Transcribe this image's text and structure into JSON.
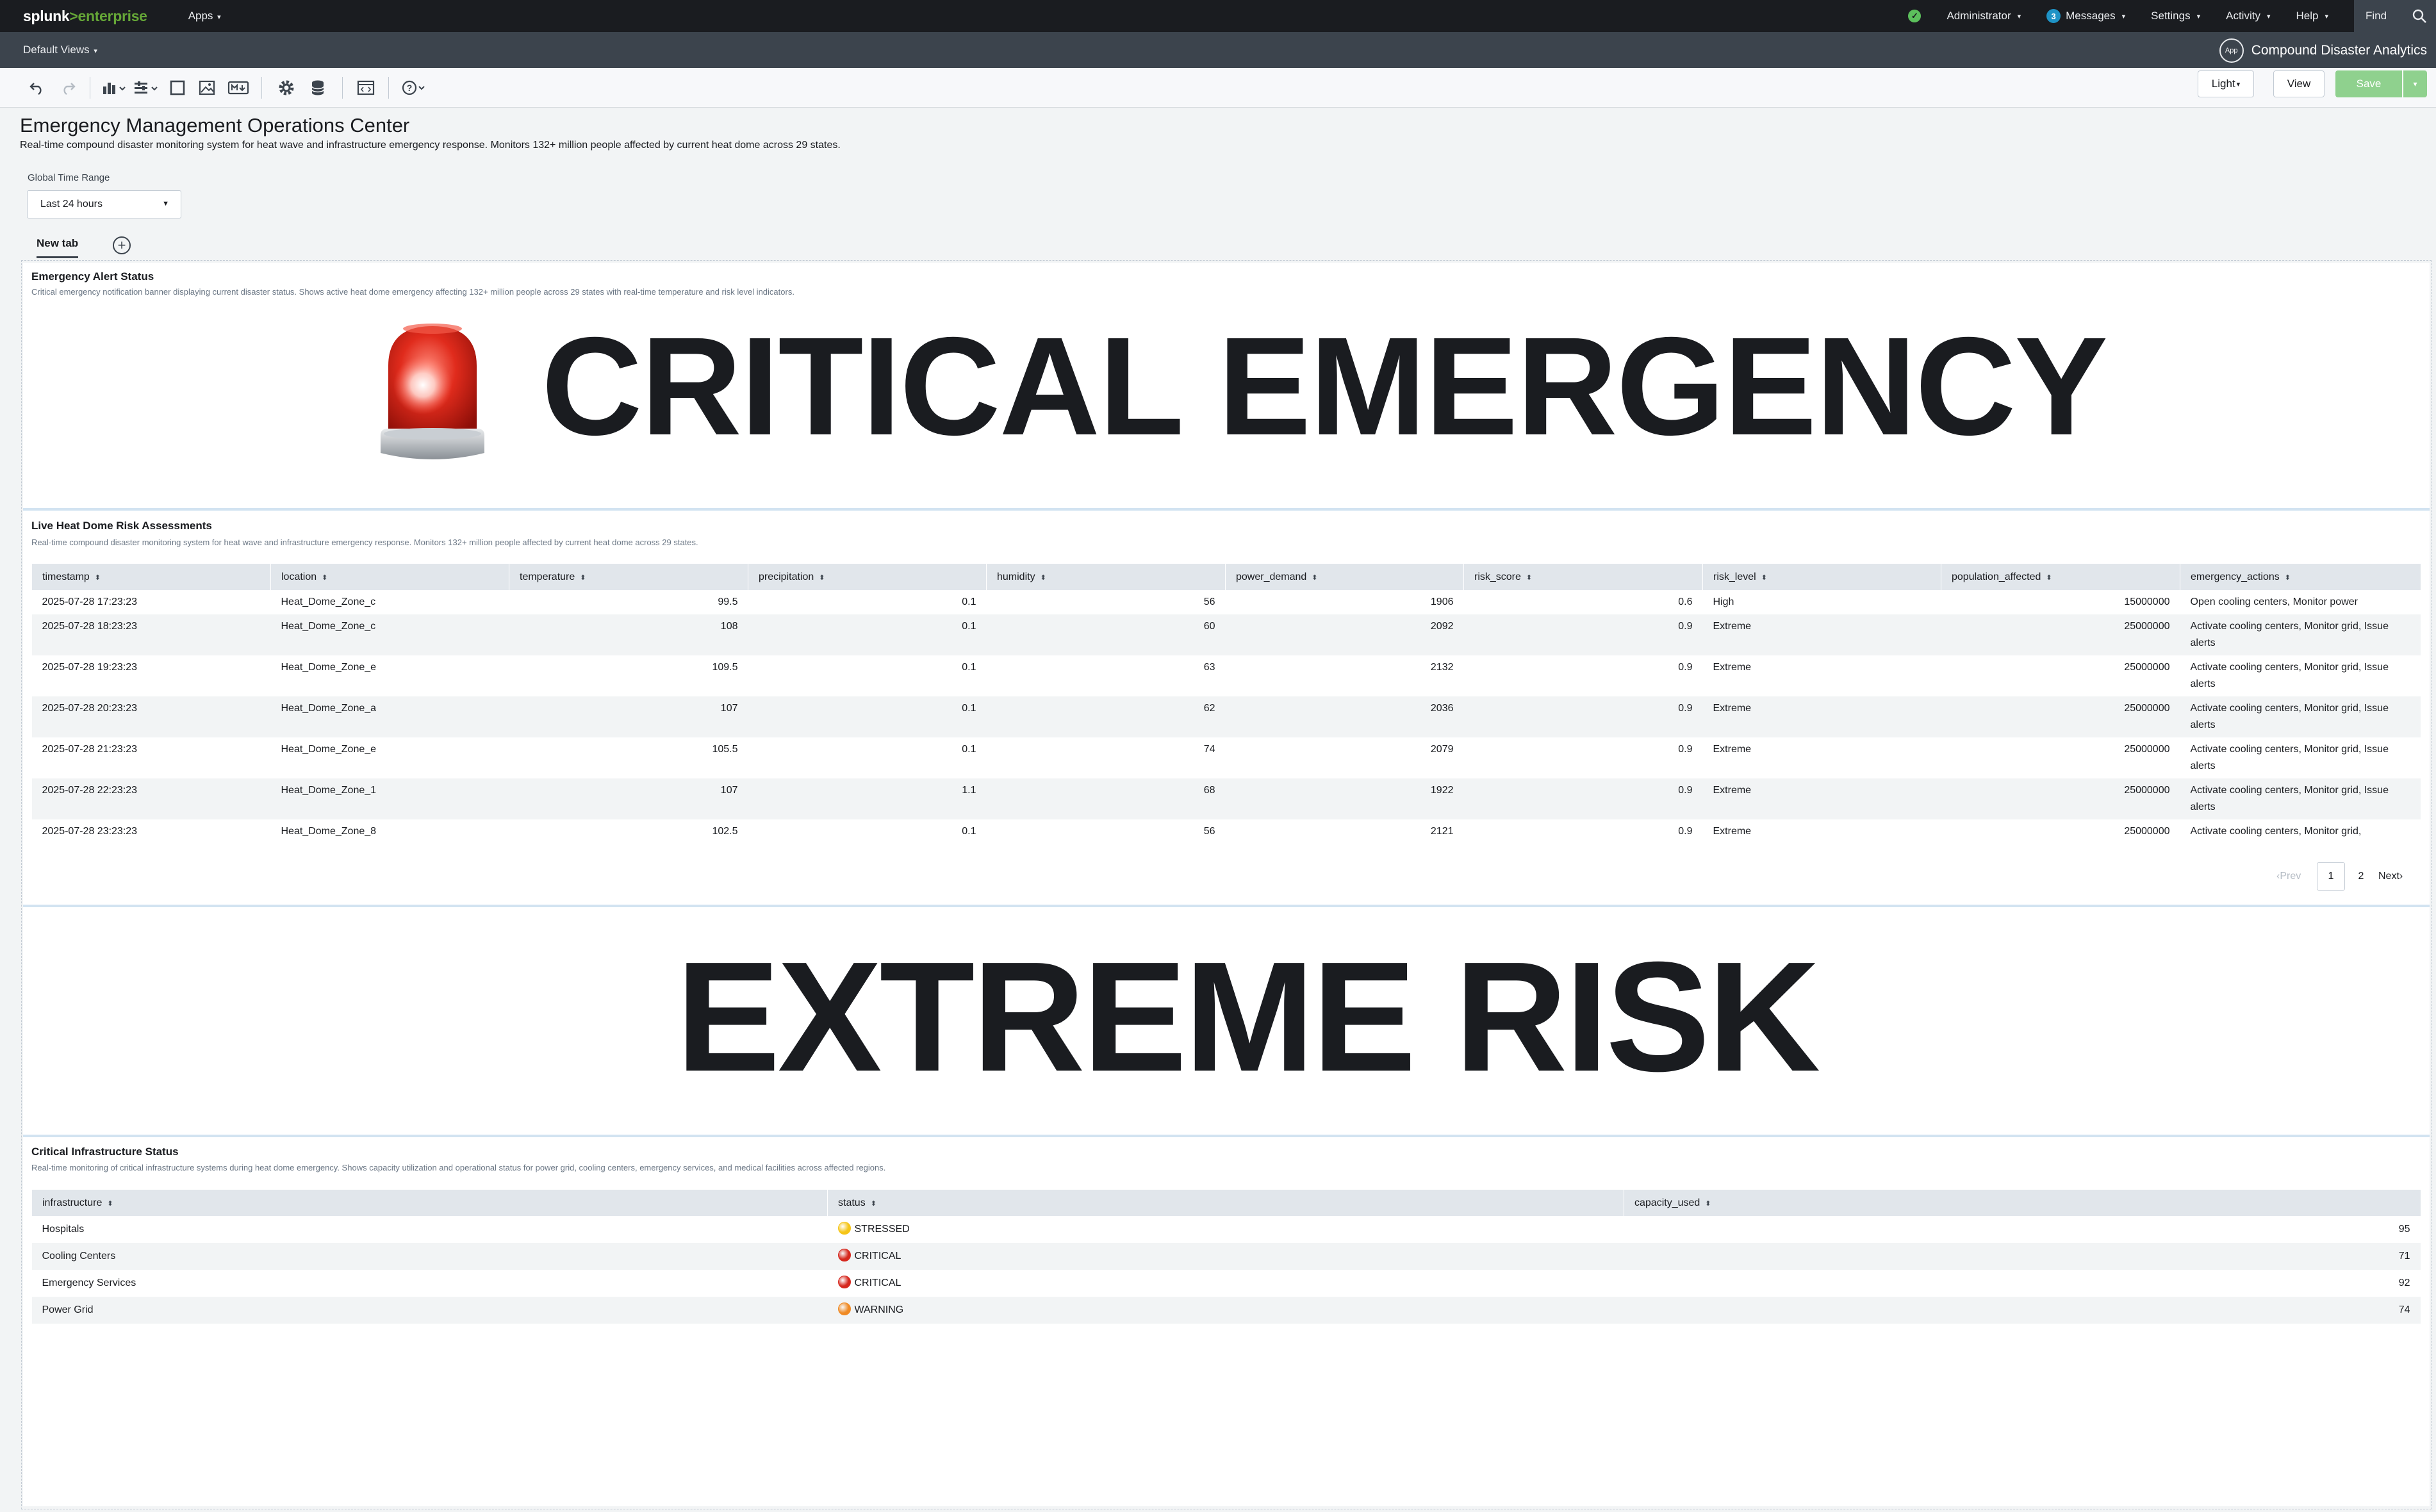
{
  "topbar": {
    "logo_left": "splunk",
    "logo_right": ">enterprise",
    "apps_label": "Apps",
    "admin_label": "Administrator",
    "messages_count": "3",
    "messages_label": "Messages",
    "settings_label": "Settings",
    "activity_label": "Activity",
    "help_label": "Help",
    "find_label": "Find"
  },
  "appbar": {
    "views_label": "Default Views",
    "app_icon_text": "App",
    "app_name": "Compound Disaster Analytics"
  },
  "toolbar": {
    "light_label": "Light",
    "view_label": "View",
    "save_label": "Save"
  },
  "dashboard": {
    "title": "Emergency Management Operations Center",
    "description": "Real-time compound disaster monitoring system for heat wave and infrastructure emergency response. Monitors 132+ million people affected by current heat dome across 29 states.",
    "time_range_label": "Global Time Range",
    "time_range_value": "Last 24 hours",
    "tab_label": "New tab"
  },
  "alert_panel": {
    "title": "Emergency Alert Status",
    "description": "Critical emergency notification banner displaying current disaster status. Shows active heat dome emergency affecting 132+ million people across 29 states with real-time temperature and risk level indicators.",
    "banner_text": "CRITICAL EMERGENCY",
    "icon": "rotating-light-siren-icon"
  },
  "risk_panel": {
    "title": "Live Heat Dome Risk Assessments",
    "description": "Real-time compound disaster monitoring system for heat wave and infrastructure emergency response. Monitors 132+ million people affected by current heat dome across 29 states.",
    "columns": [
      "timestamp",
      "location",
      "temperature",
      "precipitation",
      "humidity",
      "power_demand",
      "risk_score",
      "risk_level",
      "population_affected",
      "emergency_actions"
    ],
    "rows": [
      {
        "timestamp": "2025-07-28 17:23:23",
        "location": "Heat_Dome_Zone_c",
        "temperature": "99.5",
        "precipitation": "0.1",
        "humidity": "56",
        "power_demand": "1906",
        "risk_score": "0.6",
        "risk_level": "High",
        "population_affected": "15000000",
        "emergency_actions": "Open cooling centers, Monitor power"
      },
      {
        "timestamp": "2025-07-28 18:23:23",
        "location": "Heat_Dome_Zone_c",
        "temperature": "108",
        "precipitation": "0.1",
        "humidity": "60",
        "power_demand": "2092",
        "risk_score": "0.9",
        "risk_level": "Extreme",
        "population_affected": "25000000",
        "emergency_actions": "Activate cooling centers, Monitor grid, Issue alerts"
      },
      {
        "timestamp": "2025-07-28 19:23:23",
        "location": "Heat_Dome_Zone_e",
        "temperature": "109.5",
        "precipitation": "0.1",
        "humidity": "63",
        "power_demand": "2132",
        "risk_score": "0.9",
        "risk_level": "Extreme",
        "population_affected": "25000000",
        "emergency_actions": "Activate cooling centers, Monitor grid, Issue alerts"
      },
      {
        "timestamp": "2025-07-28 20:23:23",
        "location": "Heat_Dome_Zone_a",
        "temperature": "107",
        "precipitation": "0.1",
        "humidity": "62",
        "power_demand": "2036",
        "risk_score": "0.9",
        "risk_level": "Extreme",
        "population_affected": "25000000",
        "emergency_actions": "Activate cooling centers, Monitor grid, Issue alerts"
      },
      {
        "timestamp": "2025-07-28 21:23:23",
        "location": "Heat_Dome_Zone_e",
        "temperature": "105.5",
        "precipitation": "0.1",
        "humidity": "74",
        "power_demand": "2079",
        "risk_score": "0.9",
        "risk_level": "Extreme",
        "population_affected": "25000000",
        "emergency_actions": "Activate cooling centers, Monitor grid, Issue alerts"
      },
      {
        "timestamp": "2025-07-28 22:23:23",
        "location": "Heat_Dome_Zone_1",
        "temperature": "107",
        "precipitation": "1.1",
        "humidity": "68",
        "power_demand": "1922",
        "risk_score": "0.9",
        "risk_level": "Extreme",
        "population_affected": "25000000",
        "emergency_actions": "Activate cooling centers, Monitor grid, Issue alerts"
      },
      {
        "timestamp": "2025-07-28 23:23:23",
        "location": "Heat_Dome_Zone_8",
        "temperature": "102.5",
        "precipitation": "0.1",
        "humidity": "56",
        "power_demand": "2121",
        "risk_score": "0.9",
        "risk_level": "Extreme",
        "population_affected": "25000000",
        "emergency_actions": "Activate cooling centers, Monitor grid,"
      }
    ],
    "pagination": {
      "prev": "Prev",
      "pages": [
        "1",
        "2"
      ],
      "next": "Next",
      "current": "1"
    }
  },
  "risk_banner": {
    "text": "EXTREME RISK"
  },
  "infra_panel": {
    "title": "Critical Infrastructure Status",
    "description": "Real-time monitoring of critical infrastructure systems during heat dome emergency. Shows capacity utilization and operational status for power grid, cooling centers, emergency services, and medical facilities across affected regions.",
    "columns": [
      "infrastructure",
      "status",
      "capacity_used"
    ],
    "rows": [
      {
        "infrastructure": "Hospitals",
        "status": "STRESSED",
        "status_color": "#f5c518",
        "capacity_used": "95"
      },
      {
        "infrastructure": "Cooling Centers",
        "status": "CRITICAL",
        "status_color": "#d6281e",
        "capacity_used": "71"
      },
      {
        "infrastructure": "Emergency Services",
        "status": "CRITICAL",
        "status_color": "#d6281e",
        "capacity_used": "92"
      },
      {
        "infrastructure": "Power Grid",
        "status": "WARNING",
        "status_color": "#f08a24",
        "capacity_used": "74"
      }
    ]
  },
  "colors": {
    "brand_green": "#65a637",
    "topbar_bg": "#1a1c20",
    "appbar_bg": "#3c444d",
    "save_green": "#8fd18e",
    "accent_blue": "#1e93c6"
  }
}
